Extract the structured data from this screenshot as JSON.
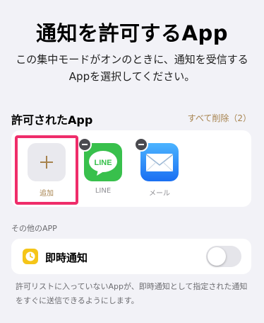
{
  "page": {
    "title": "通知を許可するApp",
    "subtitle": "この集中モードがオンのときに、通知を受信するAppを選択してください。"
  },
  "allowed_apps": {
    "header": "許可されたApp",
    "delete_all": "すべて削除（2）",
    "add_label": "追加",
    "apps": [
      {
        "label": "LINE",
        "icon": "line-app-icon"
      },
      {
        "label": "メール",
        "icon": "mail-app-icon"
      }
    ]
  },
  "other_apps": {
    "header": "その他のAPP",
    "time_sensitive_label": "即時通知",
    "time_sensitive_enabled": false,
    "note": "許可リストに入っていないAppが、即時通知として指定された通知をすぐに送信できるようにします。"
  },
  "colors": {
    "accent": "#a7834e",
    "highlight": "#ef2d6a",
    "line_green": "#38c04c",
    "mail_blue": "#1a6ff2",
    "clock_yellow": "#f5c518"
  }
}
